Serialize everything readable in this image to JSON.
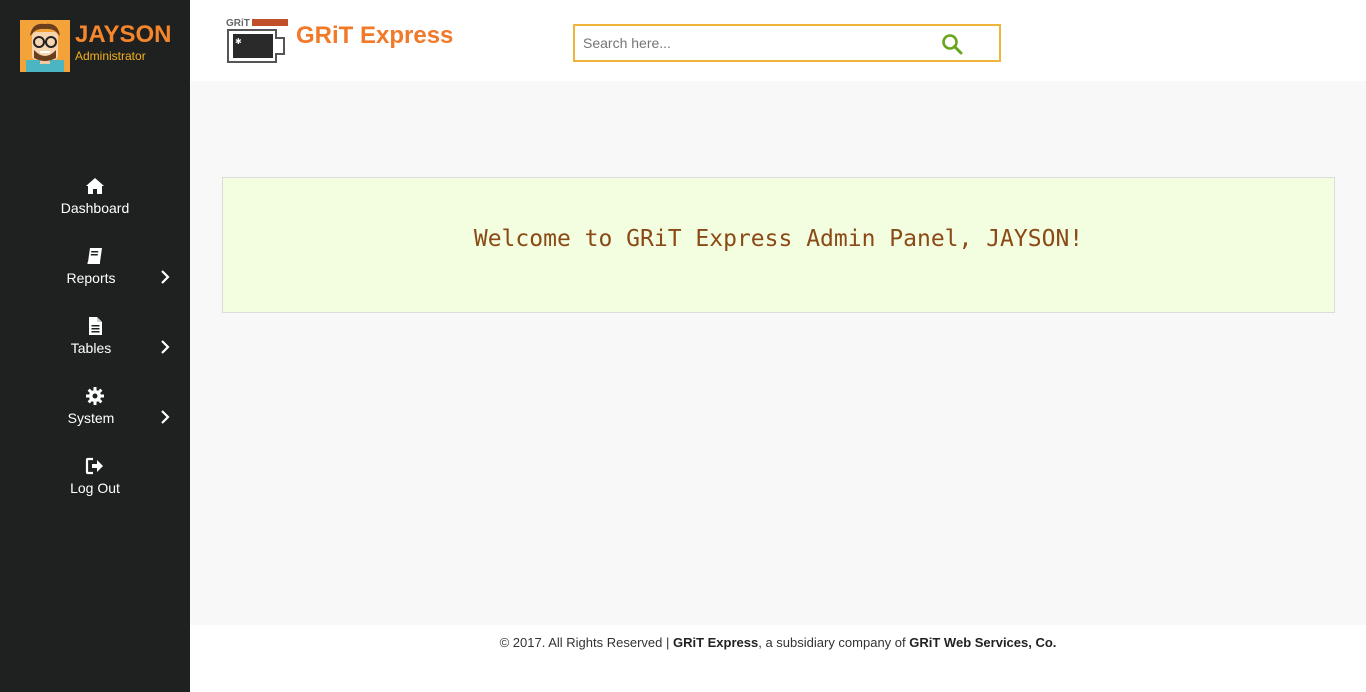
{
  "user": {
    "name": "JAYSON",
    "role": "Administrator"
  },
  "sidebar": {
    "items": [
      {
        "label": "Dashboard",
        "icon": "home-icon"
      },
      {
        "label": "Reports",
        "icon": "book-icon",
        "submenu": true
      },
      {
        "label": "Tables",
        "icon": "file-icon",
        "submenu": true
      },
      {
        "label": "System",
        "icon": "gear-icon",
        "submenu": true
      },
      {
        "label": "Log Out",
        "icon": "logout-icon"
      }
    ]
  },
  "header": {
    "brand": "GRiT Express",
    "search": {
      "placeholder": "Search here...",
      "value": ""
    }
  },
  "main": {
    "welcome": "Welcome to GRiT Express Admin Panel, JAYSON!"
  },
  "footer": {
    "prefix": "© 2017. All Rights Reserved | ",
    "brand": "GRiT Express",
    "middle": ", a subsidiary company of ",
    "company": "GRiT Web Services, Co."
  },
  "colors": {
    "sidebar_bg": "#1f2020",
    "accent_orange": "#f07a29",
    "role_yellow": "#f6b01e",
    "search_border": "#f0b43a",
    "search_icon": "#6aa51e",
    "welcome_bg": "#f3fde0",
    "welcome_text": "#8a4a16"
  }
}
